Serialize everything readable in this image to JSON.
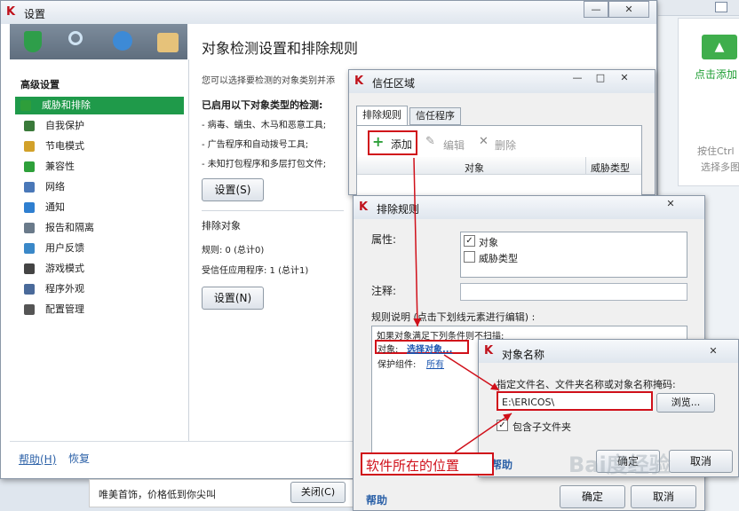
{
  "main": {
    "title": "设置",
    "section_title": "对象检测设置和排除规则",
    "intro": "您可以选择要检测的对象类别并添",
    "enabled_header": "已启用以下对象类型的检测:",
    "enabled_items": [
      "- 病毒、蠕虫、木马和恶意工具;",
      "- 广告程序和自动拨号工具;",
      "- 未知打包程序和多层打包文件;"
    ],
    "settings_btn1": "设置(S)",
    "exclusions_header": "排除对象",
    "rules": "规则: 0 (总计0)",
    "trusted_apps": "受信任应用程序: 1 (总计1)",
    "settings_btn2": "设置(N)",
    "help": "帮助(H)",
    "restore": "恢复",
    "advanced_header": "高级设置",
    "sidebar": [
      {
        "label": "威胁和排除",
        "color": "#2e9e3a"
      },
      {
        "label": "自我保护",
        "color": "#3a7a3a"
      },
      {
        "label": "节电模式",
        "color": "#d2a12a"
      },
      {
        "label": "兼容性",
        "color": "#2ea03a"
      },
      {
        "label": "网络",
        "color": "#4a78b8"
      },
      {
        "label": "通知",
        "color": "#2f7fd0"
      },
      {
        "label": "报告和隔离",
        "color": "#6a7a8a"
      },
      {
        "label": "用户反馈",
        "color": "#3a88c8"
      },
      {
        "label": "游戏模式",
        "color": "#444444"
      },
      {
        "label": "程序外观",
        "color": "#4a6a9a"
      },
      {
        "label": "配置管理",
        "color": "#555555"
      }
    ]
  },
  "ad": {
    "text": "唯美首饰，价格低到你尖叫",
    "close_label": "关闭(C)"
  },
  "right_panel": {
    "add_text": "点击添加",
    "hint1": "按住Ctrl",
    "hint2": "选择多图"
  },
  "trust": {
    "title": "信任区域",
    "tab1": "排除规则",
    "tab2": "信任程序",
    "add": "添加",
    "edit": "编辑",
    "delete": "删除",
    "col_object": "对象",
    "col_threat": "威胁类型"
  },
  "excl": {
    "title": "排除规则",
    "attr_label": "属性:",
    "opt_object": "对象",
    "opt_threat": "威胁类型",
    "comment_label": "注释:",
    "desc_label": "规则说明 (点击下划线元素进行编辑) :",
    "desc_line1": "如果对象满足下列条件则不扫描:",
    "obj_prefix": "对象:",
    "obj_link": "选择对象...",
    "comp_prefix": "保护组件:",
    "comp_link": "所有",
    "help": "帮助",
    "ok": "确定",
    "cancel": "取消"
  },
  "objname": {
    "title": "对象名称",
    "prompt": "指定文件名、文件夹名称或对象名称掩码:",
    "path": "E:\\ERICOS\\",
    "browse": "浏览...",
    "subfolders": "包含子文件夹",
    "help": "帮助",
    "ok": "确定",
    "cancel": "取消"
  },
  "annotation": {
    "text": "软件所在的位置"
  },
  "watermark": {
    "text": "Bai度经验"
  }
}
